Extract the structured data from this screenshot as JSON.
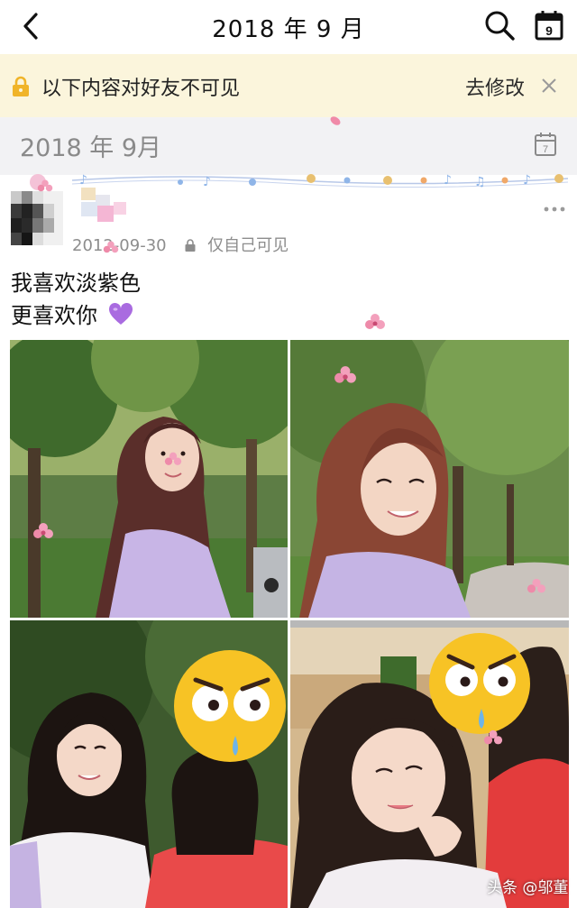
{
  "nav": {
    "title": "2018 年 9 月",
    "back_icon": "chevron-left-icon",
    "search_icon": "search-icon",
    "calendar_icon": "calendar-icon",
    "calendar_day": "9"
  },
  "notice": {
    "text": "以下内容对好友不可见",
    "edit_label": "去修改",
    "close_symbol": "×",
    "lock_color": "#f0b429",
    "background": "#fbf5dc"
  },
  "month_header": {
    "label": "2018 年 9月",
    "calendar_day": "7"
  },
  "post": {
    "date": "2012-09-30",
    "visibility": "仅自己可见",
    "text_line1": "我喜欢淡紫色",
    "text_line2": "更喜欢你",
    "emoji": "purple-heart",
    "photos": [
      {
        "name": "girl-by-trees-photo"
      },
      {
        "name": "girl-smiling-closeup-photo"
      },
      {
        "name": "two-girls-selfie-photo"
      },
      {
        "name": "selfie-with-friend-photo"
      }
    ]
  },
  "watermark": "头条 @邬董"
}
